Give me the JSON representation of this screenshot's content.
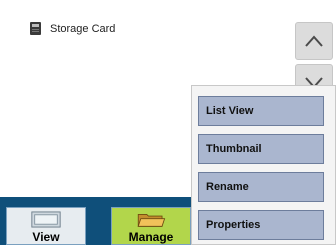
{
  "header": {
    "storage_label": "Storage Card"
  },
  "scroll": {
    "up_icon": "chevron-up-icon",
    "down_icon": "chevron-down-icon"
  },
  "toolbar": {
    "view_label": "View",
    "manage_label": "Manage"
  },
  "menu": {
    "items": [
      {
        "label": "List View"
      },
      {
        "label": "Thumbnail"
      },
      {
        "label": "Rename"
      },
      {
        "label": "Properties"
      }
    ]
  },
  "colors": {
    "toolbar_bg": "#0f4f7a",
    "manage_active": "#b2d64b",
    "menu_item_bg": "#aab6cf"
  }
}
